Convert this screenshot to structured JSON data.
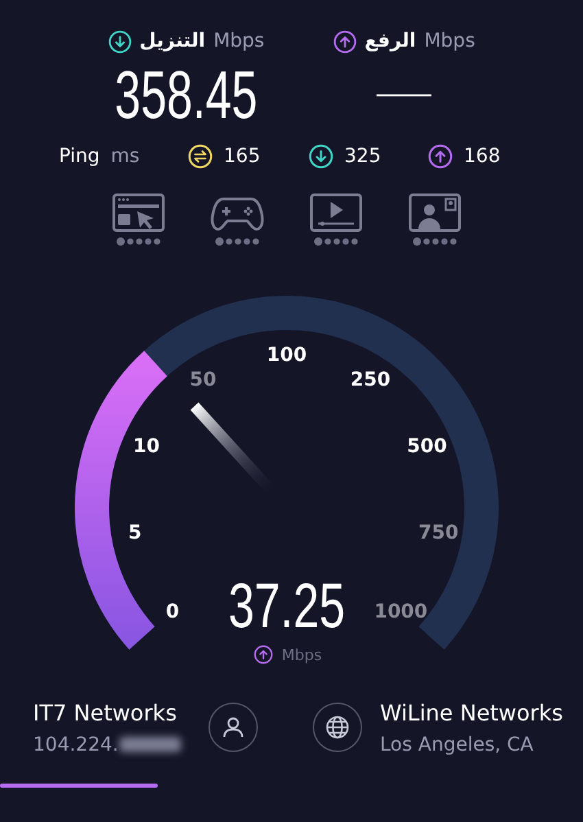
{
  "download": {
    "label": "التنزيل",
    "unit": "Mbps",
    "value": "358.45"
  },
  "upload": {
    "label": "الرفع",
    "unit": "Mbps",
    "value": "—"
  },
  "ping": {
    "label": "Ping",
    "unit": "ms",
    "items": [
      {
        "kind": "idle",
        "value": "165"
      },
      {
        "kind": "download",
        "value": "325"
      },
      {
        "kind": "upload",
        "value": "168"
      }
    ]
  },
  "experiences": [
    {
      "kind": "browsing"
    },
    {
      "kind": "gaming"
    },
    {
      "kind": "video"
    },
    {
      "kind": "video-call"
    }
  ],
  "gauge": {
    "reading": "37.25",
    "unit": "Mbps",
    "scale": [
      {
        "label": "0",
        "dim": false
      },
      {
        "label": "5",
        "dim": false
      },
      {
        "label": "10",
        "dim": false
      },
      {
        "label": "50",
        "dim": true
      },
      {
        "label": "100",
        "dim": false
      },
      {
        "label": "250",
        "dim": false
      },
      {
        "label": "500",
        "dim": false
      },
      {
        "label": "750",
        "dim": true
      },
      {
        "label": "1000",
        "dim": true
      }
    ]
  },
  "provider": {
    "name": "IT7 Networks",
    "ip": "104.224."
  },
  "server": {
    "name": "WiLine Networks",
    "location": "Los Angeles, CA"
  },
  "progress": {
    "level": 0.27
  }
}
